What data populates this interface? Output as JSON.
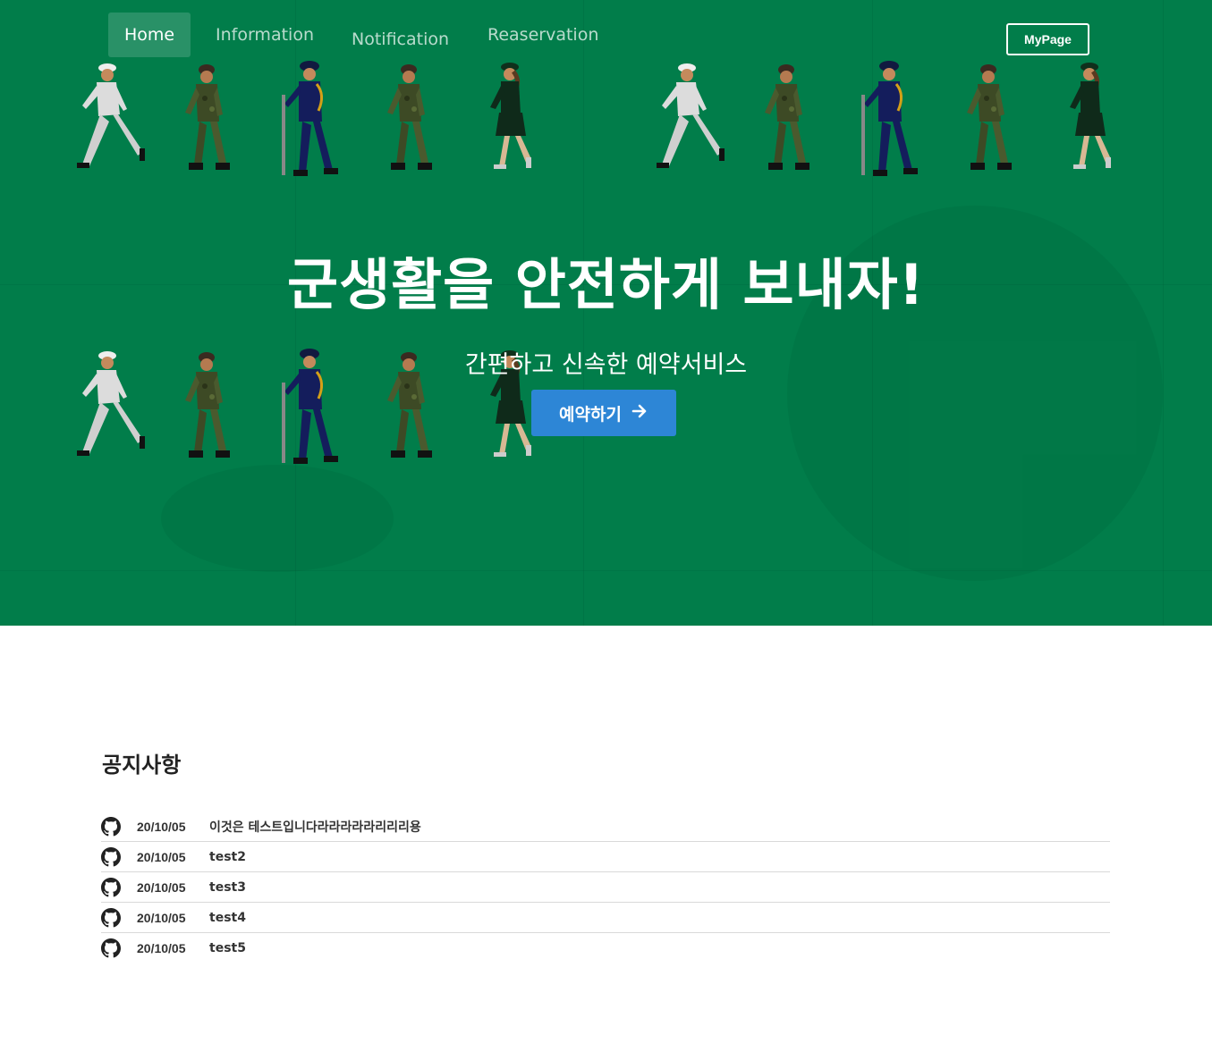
{
  "nav": {
    "links": [
      {
        "label": "Home",
        "active": true
      },
      {
        "label": "Information",
        "active": false
      },
      {
        "label": "Notification",
        "active": false
      },
      {
        "label": "Reaservation",
        "active": false
      }
    ],
    "mypage_label": "MyPage"
  },
  "hero": {
    "title": "군생활을 안전하게 보내자!",
    "subtitle": "간편하고 신속한 예약서비스",
    "cta_label": "예약하기",
    "cta_icon": "arrow-right-icon",
    "background_color": "#017d4a",
    "cta_color": "#2d86d6",
    "figures": [
      "navy-sailor",
      "army-soldier",
      "naval-officer",
      "army-soldier",
      "female-officer"
    ]
  },
  "notices": {
    "title": "공지사항",
    "icon": "github-icon",
    "items": [
      {
        "date": "20/10/05",
        "text": "이것은 테스트입니다라라라라라리리리용"
      },
      {
        "date": "20/10/05",
        "text": "test2"
      },
      {
        "date": "20/10/05",
        "text": "test3"
      },
      {
        "date": "20/10/05",
        "text": "test4"
      },
      {
        "date": "20/10/05",
        "text": "test5"
      }
    ]
  }
}
